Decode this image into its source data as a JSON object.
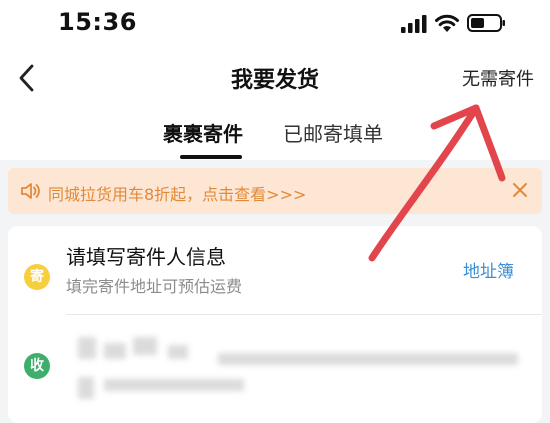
{
  "status_bar": {
    "time": "15:36"
  },
  "nav": {
    "title": "我要发货",
    "action": "无需寄件"
  },
  "tabs": [
    {
      "label": "裹裹寄件",
      "active": true
    },
    {
      "label": "已邮寄填单",
      "active": false
    }
  ],
  "notice": {
    "text": "同城拉货用车8折起，点击查看>>>",
    "color": "#e28a3a",
    "background": "#fde6d3"
  },
  "sender": {
    "badge": "寄",
    "title": "请填写寄件人信息",
    "subtitle": "填完寄件地址可预估运费",
    "address_book": "地址簿",
    "badge_color": "#f7cf3c"
  },
  "receiver": {
    "badge": "收",
    "badge_color": "#3fae6c"
  },
  "icons": {
    "back": "chevron-left-icon",
    "speaker": "speaker-icon",
    "close": "close-icon"
  },
  "colors": {
    "link": "#3a8fd6",
    "annotation": "#e3454d"
  }
}
